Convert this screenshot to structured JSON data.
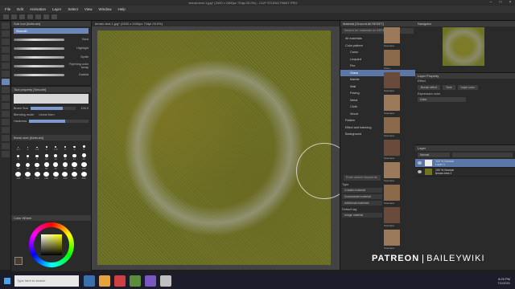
{
  "window": {
    "title": "terrain-test-1.jpg* (2400 x 2400px 72dpi 25.0%) - CLIP STUDIO PAINT PRO"
  },
  "menu": [
    "File",
    "Edit",
    "Animation",
    "Layer",
    "Select",
    "View",
    "Window",
    "Help"
  ],
  "subtool": {
    "title": "Sub tool [Airbrush]",
    "selected": "Smooth",
    "brushes": [
      {
        "label": "Hard"
      },
      {
        "label": "Soft"
      },
      {
        "label": "Highlight"
      },
      {
        "label": "Dotted"
      },
      {
        "label": "Sprite"
      },
      {
        "label": "Tone scraping"
      },
      {
        "label": "Flyrrhing color scrap"
      },
      {
        "label": "Droplet"
      },
      {
        "label": "Gadola"
      }
    ]
  },
  "tool_property": {
    "title": "Tool property [Smooth]",
    "brush_size_label": "Brush Size",
    "brush_size_value": "100.0",
    "brush_size_fill": 0.72,
    "blending_label": "Blending mode",
    "blending_value": "Linear burn",
    "hardness_label": "Hardness"
  },
  "brush_sizes": {
    "title": "Brush size [Airbrush]",
    "values": [
      "0.7",
      "1",
      "1.5",
      "2",
      "2.5",
      "3",
      "4",
      "5",
      "6",
      "7",
      "8",
      "10",
      "12",
      "15",
      "17",
      "20",
      "25",
      "30",
      "40",
      "50",
      "60",
      "70",
      "80",
      "100",
      "120",
      "150",
      "170",
      "200",
      "250",
      "300",
      "400",
      "500"
    ]
  },
  "color_wheel": {
    "title": "Color Wheel",
    "current_color": "#4a3b2b"
  },
  "canvas": {
    "tab": "terrain-test-1.jpg* (2400 x 2400px 72dpi 25.0%)"
  },
  "materials": {
    "title": "Material [Ground All RESET]",
    "search_placeholder": "Search for materials on ASSETS",
    "tree": [
      {
        "label": "All materials",
        "level": 0
      },
      {
        "label": "Color pattern",
        "level": 0
      },
      {
        "label": "Camo",
        "level": 1
      },
      {
        "label": "Leopard",
        "level": 1
      },
      {
        "label": "Fire",
        "level": 1
      },
      {
        "label": "Grass",
        "level": 1,
        "selected": true
      },
      {
        "label": "Marble",
        "level": 1
      },
      {
        "label": "Wall",
        "level": 1
      },
      {
        "label": "Paving",
        "level": 1
      },
      {
        "label": "Metal",
        "level": 1
      },
      {
        "label": "Cloth",
        "level": 1
      },
      {
        "label": "Wood",
        "level": 1
      },
      {
        "label": "Pattern",
        "level": 0
      },
      {
        "label": "Effect and hatching",
        "level": 0
      },
      {
        "label": "Background",
        "level": 0
      }
    ],
    "thumbs": [
      "Seamless",
      "Stone",
      "Seamless",
      "Seamless",
      "Seamless",
      "Seamless",
      "Seamless",
      "Seamless",
      "Seamless",
      "Seamless"
    ],
    "lower_search": "Enter search keywords",
    "type_label": "Type",
    "buttons": [
      "Created material",
      "Downloaded material",
      "Additional materials"
    ],
    "default_tag": "Default tag",
    "image_material": "Image material"
  },
  "navigator": {
    "title": "Navigator"
  },
  "layer_property": {
    "title": "Layer Property",
    "effect_label": "Effect",
    "buttons": [
      "Border effect",
      "Tone",
      "Layer color"
    ],
    "expression_label": "Expression color",
    "expression_value": "Color"
  },
  "layers": {
    "title": "Layer",
    "blend_value": "Normal",
    "rows": [
      {
        "name": "100 % Normal",
        "sub": "Layer 1",
        "selected": true,
        "thumb": "white"
      },
      {
        "name": "100 % Normal",
        "sub": "terrain-test-2",
        "selected": false,
        "thumb": "tex"
      }
    ]
  },
  "watermark": {
    "left": "PATREON",
    "right": "BAILEYWIKI"
  },
  "taskbar": {
    "search": "Type here to search",
    "time": "8:25 PM",
    "date": "7/1/2021"
  },
  "colors": {
    "accent": "#5a77a8",
    "panel": "#2a2a2a",
    "canvas_bg": "#434343"
  }
}
